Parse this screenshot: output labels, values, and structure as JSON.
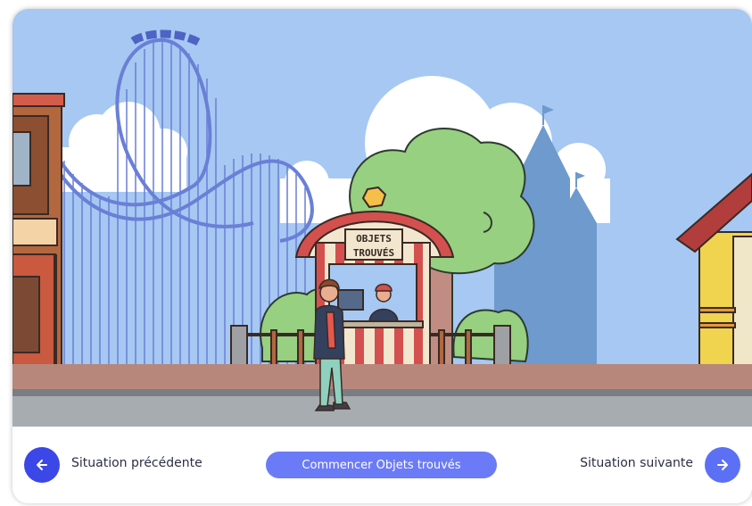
{
  "scene": {
    "booth_sign_line1": "OBJETS",
    "booth_sign_line2": "TROUVÉS"
  },
  "footer": {
    "prev_label": "Situation précédente",
    "start_label": "Commencer Objets trouvés",
    "next_label": "Situation suivante",
    "prev_icon": "arrow-left-icon",
    "next_icon": "arrow-right-icon"
  },
  "colors": {
    "sky": "#a6c8f2",
    "accent_dark": "#3c47e8",
    "accent_light": "#6b7bf7",
    "booth_red": "#d3504f",
    "tree_green": "#97d080"
  }
}
